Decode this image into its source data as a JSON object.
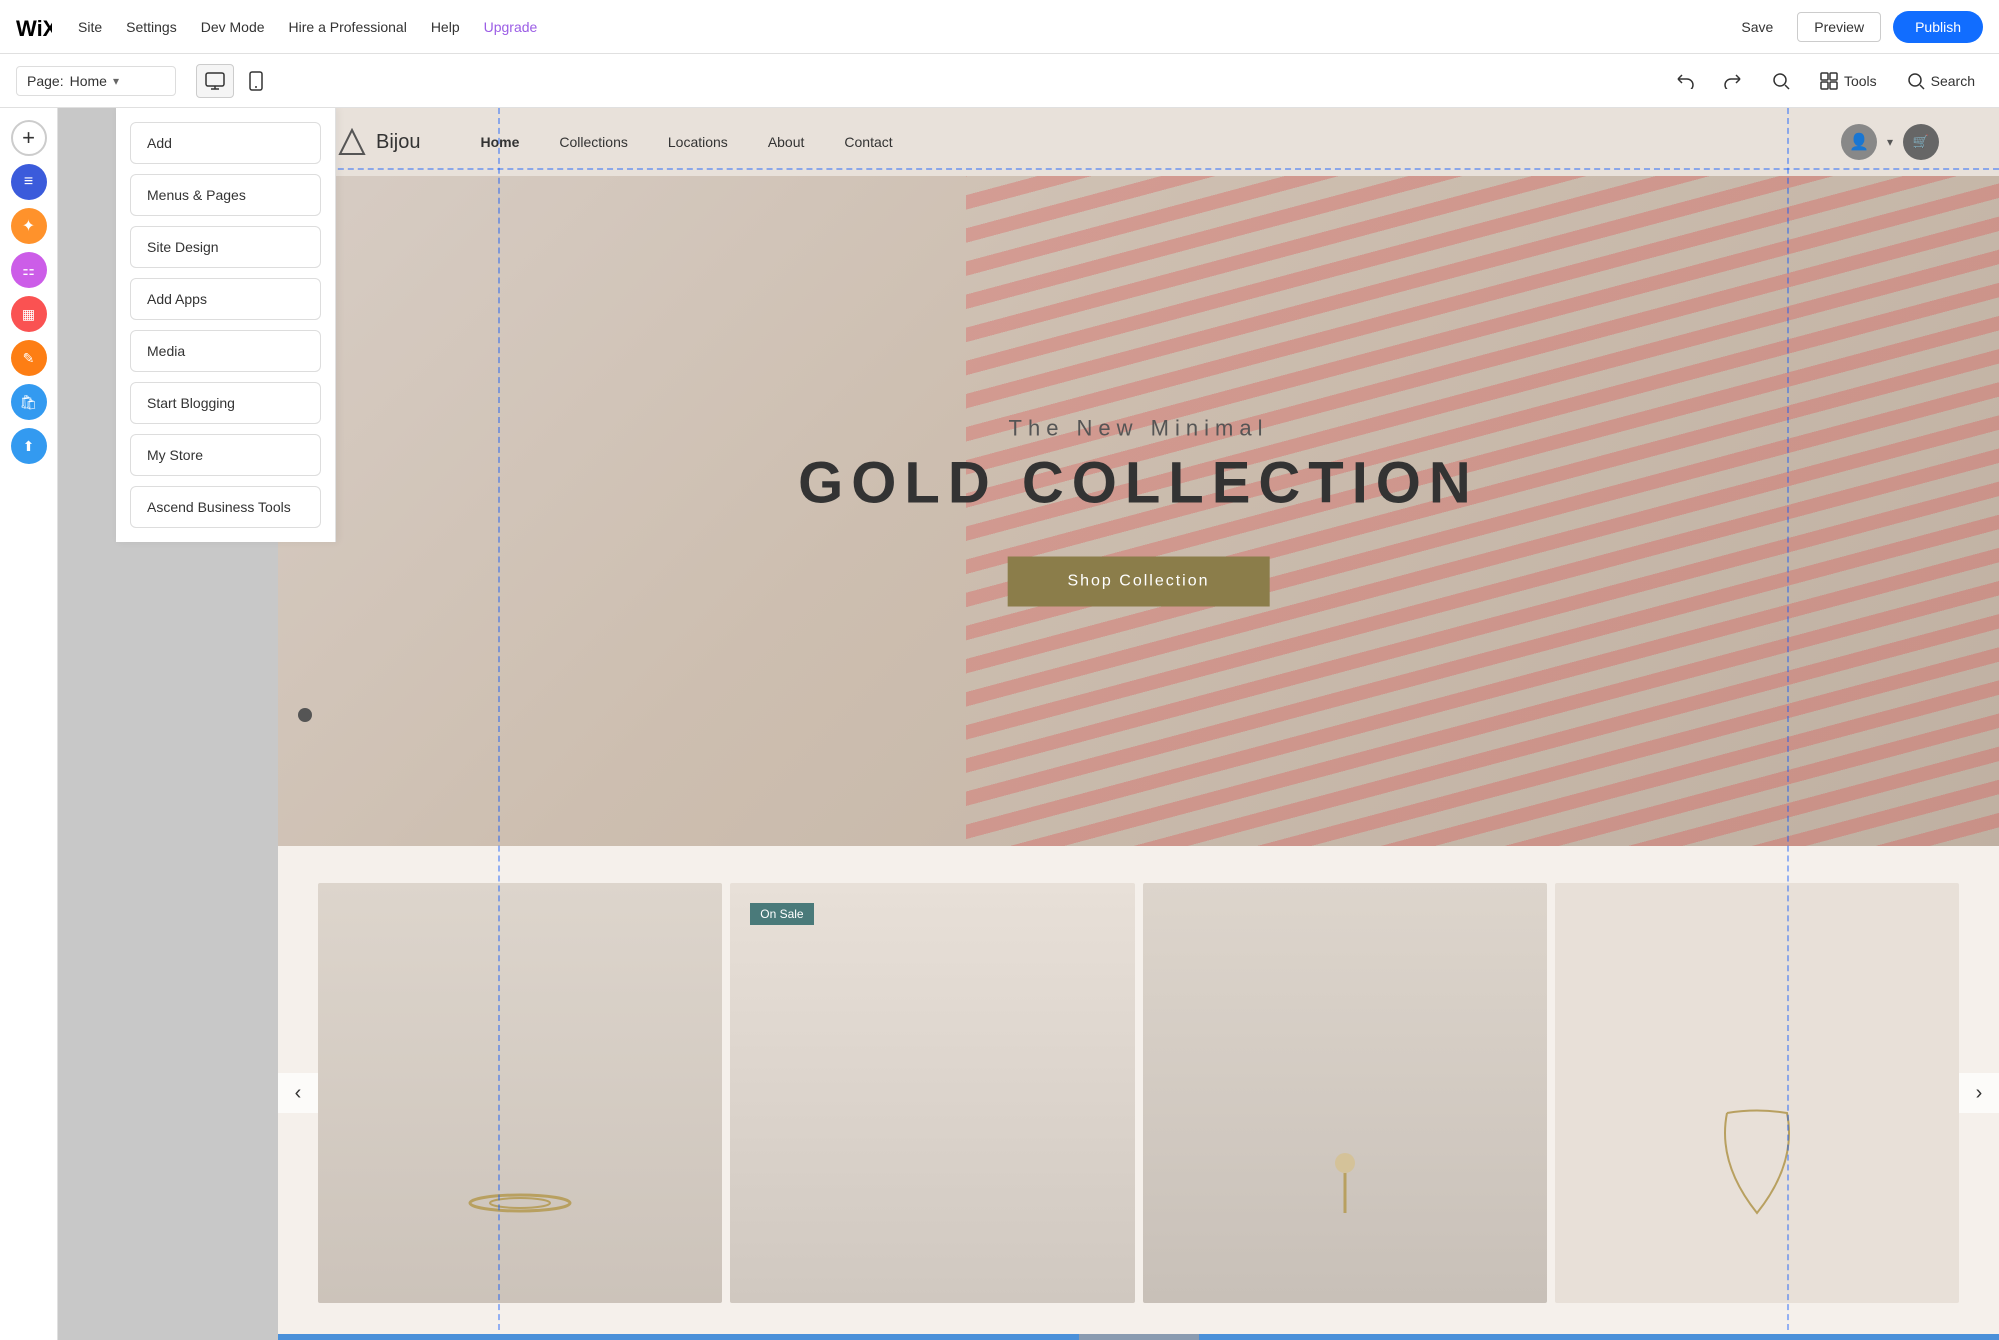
{
  "topbar": {
    "logo_text": "wix",
    "nav_items": [
      {
        "label": "Site",
        "id": "site"
      },
      {
        "label": "Settings",
        "id": "settings"
      },
      {
        "label": "Dev Mode",
        "id": "dev-mode"
      },
      {
        "label": "Hire a Professional",
        "id": "hire"
      },
      {
        "label": "Help",
        "id": "help"
      },
      {
        "label": "Upgrade",
        "id": "upgrade"
      }
    ],
    "save_label": "Save",
    "preview_label": "Preview",
    "publish_label": "Publish"
  },
  "secondbar": {
    "page_label": "Page:",
    "page_name": "Home",
    "tools_label": "Tools",
    "search_label": "Search"
  },
  "sidebar": {
    "buttons": [
      {
        "id": "add",
        "label": "Add",
        "icon": "+"
      },
      {
        "id": "menus-pages",
        "label": "Menus & Pages",
        "icon": "≡"
      },
      {
        "id": "site-design",
        "label": "Site Design",
        "icon": "◉"
      },
      {
        "id": "add-apps",
        "label": "Add Apps",
        "icon": "⚏"
      },
      {
        "id": "media",
        "label": "Media",
        "icon": "▦"
      },
      {
        "id": "start-blogging",
        "label": "Start Blogging",
        "icon": "✎"
      },
      {
        "id": "my-store",
        "label": "My Store",
        "icon": "🛍"
      },
      {
        "id": "ascend",
        "label": "Ascend Business Tools",
        "icon": "⬆"
      }
    ]
  },
  "panel": {
    "buttons": [
      {
        "id": "menus-pages",
        "label": "Menus & Pages"
      },
      {
        "id": "site-design",
        "label": "Site Design"
      },
      {
        "id": "add-apps",
        "label": "Add Apps"
      },
      {
        "id": "media",
        "label": "Media"
      },
      {
        "id": "start-blogging",
        "label": "Start Blogging"
      },
      {
        "id": "my-store",
        "label": "My Store"
      },
      {
        "id": "ascend-business-tools",
        "label": "Ascend Business Tools"
      }
    ]
  },
  "site": {
    "logo_text": "Bijou",
    "nav_links": [
      {
        "label": "Home",
        "active": true
      },
      {
        "label": "Collections",
        "active": false
      },
      {
        "label": "Locations",
        "active": false
      },
      {
        "label": "About",
        "active": false
      },
      {
        "label": "Contact",
        "active": false
      }
    ],
    "hero": {
      "subtitle": "The New Minimal",
      "title": "GOLD COLLECTION",
      "cta_button": "Shop Collection"
    },
    "products": {
      "on_sale_badge": "On Sale",
      "prev_arrow": "‹",
      "next_arrow": "›"
    }
  },
  "colors": {
    "publish_btn": "#116dff",
    "upgrade_link": "#9b5de5",
    "hero_btn": "#8b7d4a",
    "on_sale": "#4a7a7a"
  }
}
